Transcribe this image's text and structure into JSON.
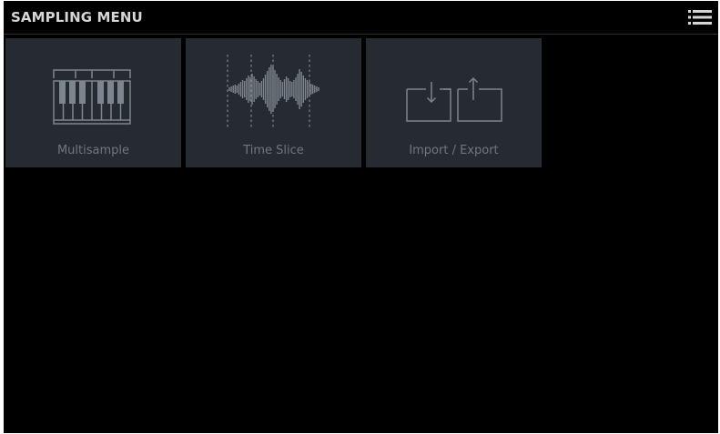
{
  "header": {
    "title": "SAMPLING MENU",
    "menu_icon": "hamburger-list-icon"
  },
  "tiles": [
    {
      "label": "Multisample",
      "icon": "piano-keyboard-icon"
    },
    {
      "label": "Time Slice",
      "icon": "waveform-slice-icon"
    },
    {
      "label": "Import / Export",
      "icon": "import-export-icon"
    }
  ],
  "colors": {
    "background": "#000000",
    "tile": "#252b31",
    "icon": "#7d858e",
    "label": "#6f7780",
    "title": "#d4d6d8"
  }
}
